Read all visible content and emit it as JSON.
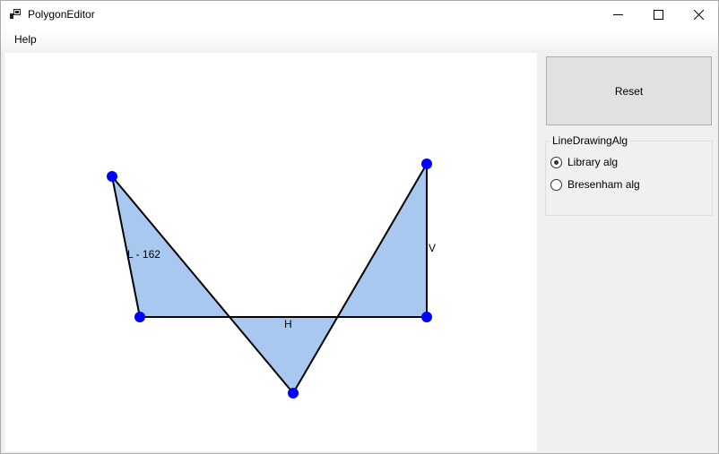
{
  "window": {
    "title": "PolygonEditor"
  },
  "menu": {
    "items": [
      "Help"
    ]
  },
  "canvas": {
    "fill_color": "#a9c8f0",
    "vertex_color": "#0000ff",
    "edge_color": "#000000",
    "edge_labels": {
      "length": "L - 162",
      "horizontal": "H",
      "vertical": "V"
    }
  },
  "panel": {
    "reset_label": "Reset",
    "group_title": "LineDrawingAlg",
    "options": [
      {
        "label": "Library alg",
        "checked": true
      },
      {
        "label": "Bresenham alg",
        "checked": false
      }
    ]
  }
}
